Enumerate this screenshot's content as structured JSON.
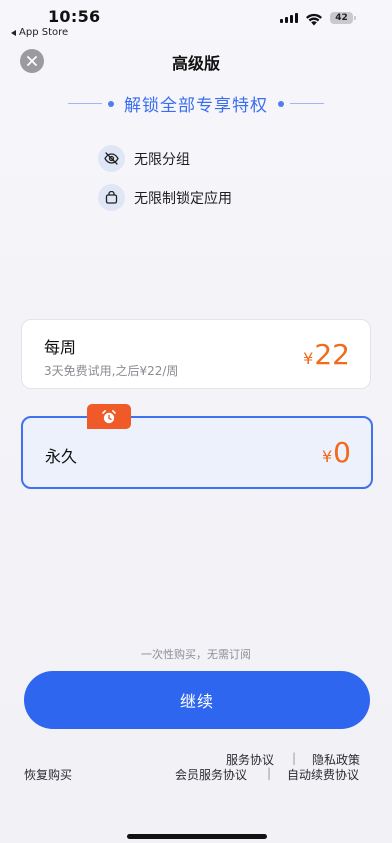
{
  "status_bar": {
    "time": "10:56",
    "back_app": "App Store",
    "battery": "42"
  },
  "header": {
    "title": "高级版",
    "close_icon": "close-icon"
  },
  "unlock_heading": "解锁全部专享特权",
  "features": [
    {
      "label": "无限分组",
      "icon": "eye-off-icon"
    },
    {
      "label": "无限制锁定应用",
      "icon": "lock-app-icon"
    }
  ],
  "plans": {
    "weekly": {
      "name": "每周",
      "subtitle": "3天免费试用,之后¥22/周",
      "currency": "¥",
      "price": "22"
    },
    "lifetime": {
      "name": "永久",
      "currency": "¥",
      "price": "0",
      "badge_icon": "alarm-clock-icon",
      "selected": true
    }
  },
  "note": "一次性购买，无需订阅",
  "continue_label": "继续",
  "footer": {
    "restore": "恢复购买",
    "service_agreement": "服务协议",
    "privacy_policy": "隐私政策",
    "member_service_agreement": "会员服务协议",
    "auto_renew_agreement": "自动续费协议",
    "separator": "|"
  },
  "colors": {
    "accent": "#2e66ef",
    "price": "#f26a1b",
    "badge": "#f05a28"
  }
}
